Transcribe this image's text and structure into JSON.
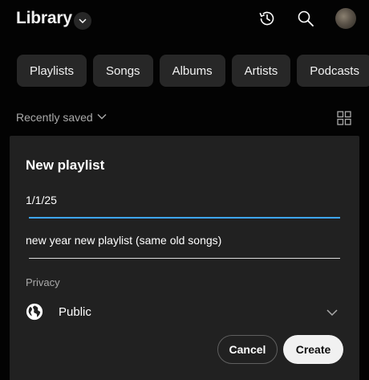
{
  "header": {
    "title": "Library"
  },
  "chips": [
    "Playlists",
    "Songs",
    "Albums",
    "Artists",
    "Podcasts"
  ],
  "sort": {
    "label": "Recently saved"
  },
  "dialog": {
    "title": "New playlist",
    "title_value": "1/1/25",
    "description_value": "new year new playlist (same old songs)",
    "privacy_label": "Privacy",
    "privacy_value": "Public",
    "cancel_label": "Cancel",
    "create_label": "Create"
  },
  "colors": {
    "accent": "#3ea6ff",
    "background": "#030303",
    "dialog": "#212121",
    "chip": "#272727"
  }
}
